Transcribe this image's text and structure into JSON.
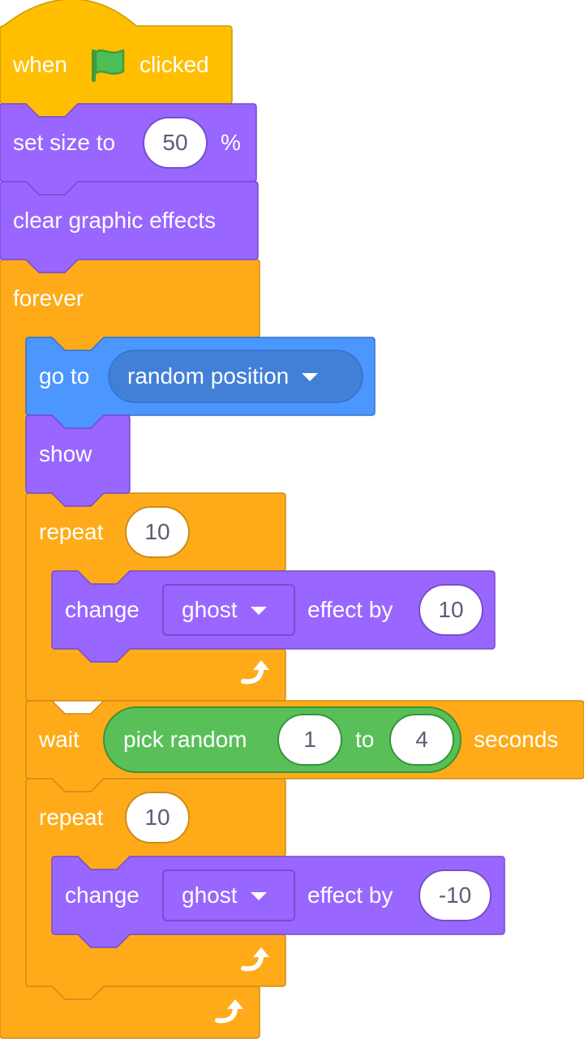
{
  "script": {
    "hat": {
      "when_label": "when",
      "flag_icon": "green-flag-icon",
      "clicked_label": "clicked"
    },
    "set_size": {
      "label": "set size to",
      "value": "50",
      "unit": "%"
    },
    "clear_effects": {
      "label": "clear graphic effects"
    },
    "forever": {
      "label": "forever"
    },
    "go_to": {
      "label": "go to",
      "menu_value": "random position"
    },
    "show": {
      "label": "show"
    },
    "repeat1": {
      "label": "repeat",
      "count": "10"
    },
    "change1": {
      "label": "change",
      "effect": "ghost",
      "by_label": "effect by",
      "value": "10"
    },
    "wait": {
      "label": "wait",
      "op_label": "pick random",
      "from": "1",
      "to_label": "to",
      "to": "4",
      "unit": "seconds"
    },
    "repeat2": {
      "label": "repeat",
      "count": "10"
    },
    "change2": {
      "label": "change",
      "effect": "ghost",
      "by_label": "effect by",
      "value": "-10"
    },
    "loop_arrow_icon": "loop-arrow-icon"
  },
  "colors": {
    "events": "#ffbf00",
    "events_border": "#cc9900",
    "looks": "#9966ff",
    "looks_border": "#774dcb",
    "control": "#ffab19",
    "control_border": "#cf8b17",
    "motion": "#4c97ff",
    "motion_border": "#3373cc",
    "operators": "#59c059",
    "operators_border": "#389438"
  }
}
